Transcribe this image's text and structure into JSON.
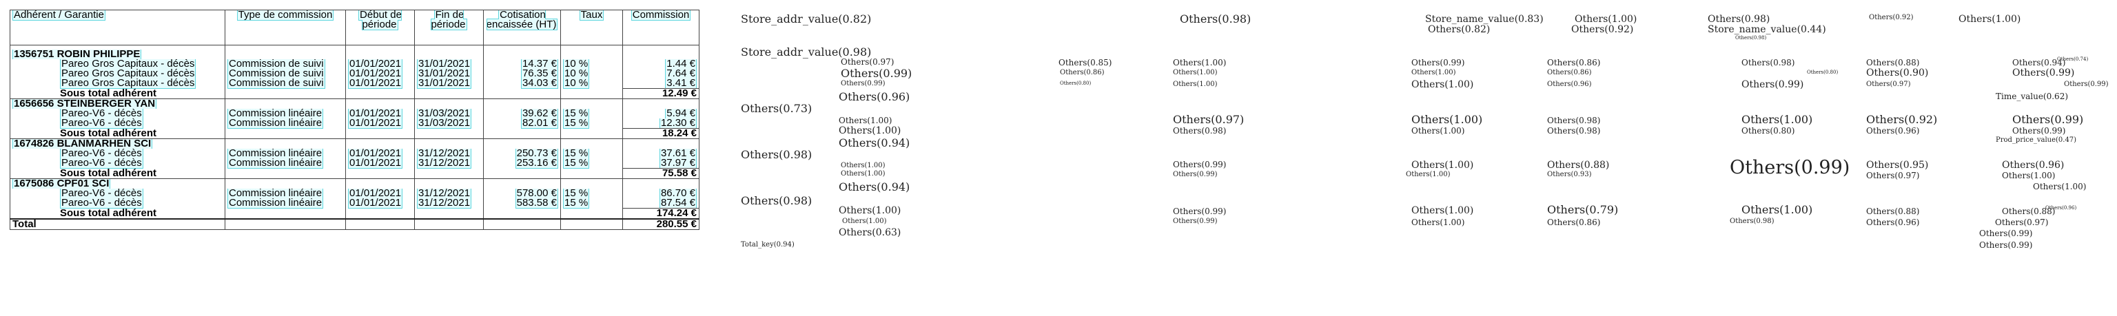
{
  "headers": {
    "holder": "Adhérent / Garantie",
    "type": "Type de commission",
    "start": "Début de période",
    "end": "Fin de période",
    "collected": "Cotisation encaissée (HT)",
    "rate": "Taux",
    "commission": "Commission"
  },
  "groups": [
    {
      "name": "1356751 ROBIN PHILIPPE",
      "rows": [
        {
          "garantie": "Pareo Gros Capitaux - décès",
          "type": "Commission de suivi",
          "start": "01/01/2021",
          "end": "31/01/2021",
          "collected": "14.37 €",
          "rate": "10 %",
          "commission": "1.44 €"
        },
        {
          "garantie": "Pareo Gros Capitaux - décès",
          "type": "Commission de suivi",
          "start": "01/01/2021",
          "end": "31/01/2021",
          "collected": "76.35 €",
          "rate": "10 %",
          "commission": "7.64 €"
        },
        {
          "garantie": "Pareo Gros Capitaux - décès",
          "type": "Commission de suivi",
          "start": "01/01/2021",
          "end": "31/01/2021",
          "collected": "34.03 €",
          "rate": "10 %",
          "commission": "3.41 €"
        }
      ],
      "subtotal_label": "Sous total adhérent",
      "subtotal": "12.49 €"
    },
    {
      "name": "1656656 STEINBERGER YAN",
      "rows": [
        {
          "garantie": "Pareo-V6 - décès",
          "type": "Commission linéaire",
          "start": "01/01/2021",
          "end": "31/03/2021",
          "collected": "39.62 €",
          "rate": "15 %",
          "commission": "5.94 €"
        },
        {
          "garantie": "Pareo-V6 - décès",
          "type": "Commission linéaire",
          "start": "01/01/2021",
          "end": "31/03/2021",
          "collected": "82.01 €",
          "rate": "15 %",
          "commission": "12.30 €"
        }
      ],
      "subtotal_label": "Sous total adhérent",
      "subtotal": "18.24 €"
    },
    {
      "name": "1674826 BLANMARHEN SCI",
      "rows": [
        {
          "garantie": "Pareo-V6 - décès",
          "type": "Commission linéaire",
          "start": "01/01/2021",
          "end": "31/12/2021",
          "collected": "250.73 €",
          "rate": "15 %",
          "commission": "37.61 €"
        },
        {
          "garantie": "Pareo-V6 - décès",
          "type": "Commission linéaire",
          "start": "01/01/2021",
          "end": "31/12/2021",
          "collected": "253.16 €",
          "rate": "15 %",
          "commission": "37.97 €"
        }
      ],
      "subtotal_label": "Sous total adhérent",
      "subtotal": "75.58 €"
    },
    {
      "name": "1675086 CPF01 SCI",
      "rows": [
        {
          "garantie": "Pareo-V6 - décès",
          "type": "Commission linéaire",
          "start": "01/01/2021",
          "end": "31/12/2021",
          "collected": "578.00 €",
          "rate": "15 %",
          "commission": "86.70 €"
        },
        {
          "garantie": "Pareo-V6 - décès",
          "type": "Commission linéaire",
          "start": "01/01/2021",
          "end": "31/12/2021",
          "collected": "583.58 €",
          "rate": "15 %",
          "commission": "87.54 €"
        }
      ],
      "subtotal_label": "Sous total adhérent",
      "subtotal": "174.24 €"
    }
  ],
  "total_label": "Total",
  "total": "280.55 €",
  "annotations": [
    "Store_addr_value(0.82)",
    "Others(0.98)",
    "Store_name_value(0.83)",
    "Others(0.82)",
    "Others(1.00)",
    "Others(0.92)",
    "Others(0.98)",
    "Store_name_value(0.44)",
    "Others(0.98)",
    "Others(0.92)",
    "Others(1.00)",
    "Store_addr_value(0.98)",
    "Others(0.97)",
    "Others(0.99)",
    "Others(0.99)",
    "Others(0.96)",
    "Others(0.85)",
    "Others(0.86)",
    "Others(0.80)",
    "Others(1.00)",
    "Others(1.00)",
    "Others(1.00)",
    "Others(0.99)",
    "Others(1.00)",
    "Others(1.00)",
    "Others(0.86)",
    "Others(0.86)",
    "Others(0.96)",
    "Others(0.98)",
    "Others(0.80)",
    "Others(0.99)",
    "Others(0.88)",
    "Others(0.90)",
    "Others(0.97)",
    "Others(0.94)",
    "Others(0.74)",
    "Others(0.99)",
    "Others(0.99)",
    "Time_value(0.62)",
    "Others(0.73)",
    "Others(1.00)",
    "Others(1.00)",
    "Others(0.94)",
    "Others(0.97)",
    "Others(0.98)",
    "Others(1.00)",
    "Others(1.00)",
    "Others(0.98)",
    "Others(0.98)",
    "Others(1.00)",
    "Others(0.80)",
    "Others(0.92)",
    "Others(0.96)",
    "Others(0.99)",
    "Others(0.99)",
    "Prod_price_value(0.47)",
    "Others(0.98)",
    "Others(1.00)",
    "Others(1.00)",
    "Others(0.94)",
    "Others(0.99)",
    "Others(0.99)",
    "Others(1.00)",
    "Others(1.00)",
    "Others(0.88)",
    "Others(0.93)",
    "Others(0.99)",
    "Others(0.95)",
    "Others(0.97)",
    "Others(0.96)",
    "Others(1.00)",
    "Others(1.00)",
    "Others(0.98)",
    "Others(1.00)",
    "Others(1.00)",
    "Others(0.63)",
    "Others(0.99)",
    "Others(0.99)",
    "Others(1.00)",
    "Others(1.00)",
    "Others(0.79)",
    "Others(0.86)",
    "Others(1.00)",
    "Others(0.98)",
    "Others(0.88)",
    "Others(0.96)",
    "Others(0.88)",
    "Others(0.96)",
    "Others(0.97)",
    "Others(0.99)",
    "Others(0.99)",
    "Total_key(0.94)"
  ]
}
